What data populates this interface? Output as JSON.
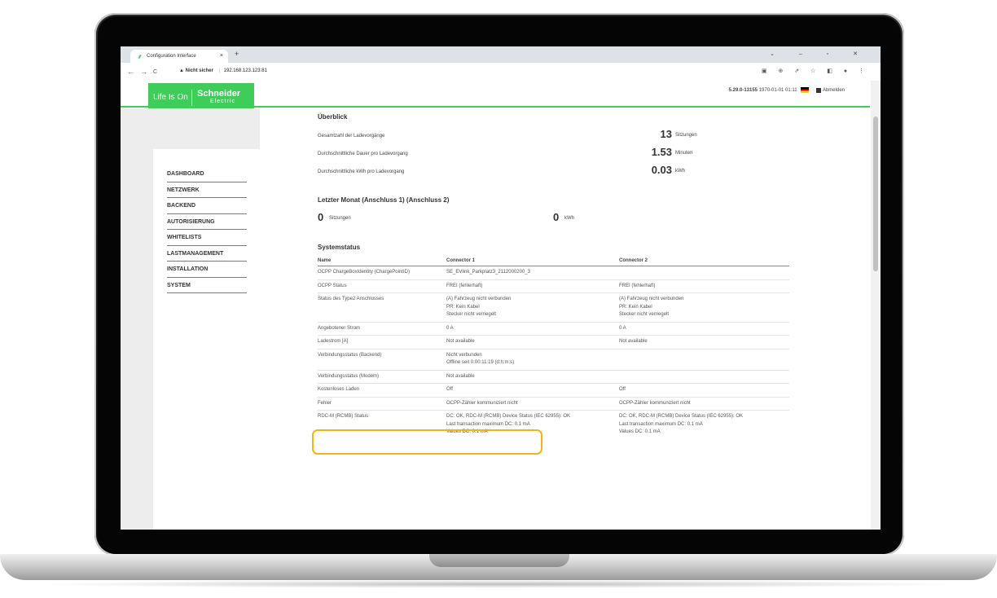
{
  "browser": {
    "tab_title": "Configuration Interface",
    "tab_close": "×",
    "new_tab": "+",
    "window_controls": "⌄ – ▫ ✕",
    "nav_back": "←",
    "nav_forward": "→",
    "nav_reload": "C",
    "url_warning": "▲ Nicht sicher",
    "url_host": "192.168.123.123:81",
    "toolbar_icons": "▣ ⊕ ⇗ ☆ ◧ ● ⋮"
  },
  "header": {
    "logo_tagline": "Life Is On",
    "logo_brand": "Schneider",
    "logo_brand_sub": "Electric",
    "version": "5.29.0-13155",
    "timestamp": "1970-01-01 01:11",
    "logout": "Abmelden",
    "accent_color": "#3dcd58"
  },
  "sidebar": {
    "items": [
      {
        "label": "DASHBOARD"
      },
      {
        "label": "NETZWERK"
      },
      {
        "label": "BACKEND"
      },
      {
        "label": "AUTORISIERUNG"
      },
      {
        "label": "WHITELISTS"
      },
      {
        "label": "LASTMANAGEMENT"
      },
      {
        "label": "INSTALLATION"
      },
      {
        "label": "SYSTEM"
      }
    ]
  },
  "overview": {
    "title": "Überblick",
    "rows": [
      {
        "label": "Gesamtzahl der Ladevorgänge",
        "value": "13",
        "unit": "Sitzungen"
      },
      {
        "label": "Durchschnittliche Dauer pro Ladevorgang",
        "value": "1.53",
        "unit": "Minuten"
      },
      {
        "label": "Durchschnittliche kWh pro Ladevorgang",
        "value": "0.03",
        "unit": "kWh"
      }
    ]
  },
  "last_month": {
    "title": "Letzter Monat (Anschluss 1) (Anschluss 2)",
    "sessions_value": "0",
    "sessions_unit": "Sitzungen",
    "kwh_value": "0",
    "kwh_unit": "kWh"
  },
  "system_status": {
    "title": "Systemstatus",
    "headers": [
      "Name",
      "Connector 1",
      "Connector 2"
    ],
    "rows": [
      {
        "name": "OCPP ChargeBoxIdentity (ChargePointID)",
        "c1": "SE_EVlink_Parkplatz3_2112000200_3",
        "c2": ""
      },
      {
        "name": "OCPP Status",
        "c1": "FREI (fehlerhaft)",
        "c2": "FREI (fehlerhaft)"
      },
      {
        "name": "Status des Type2 Anschlusses",
        "c1": "(A) Fahrzeug nicht verbunden\nPR: Kein Kabel\nStecker nicht verriegelt",
        "c2": "(A) Fahrzeug nicht verbunden\nPR: Kein Kabel\nStecker nicht verriegelt"
      },
      {
        "name": "Angebotener Strom",
        "c1": "0 A",
        "c2": "0 A"
      },
      {
        "name": "Ladestrom [A]",
        "c1": "Not available",
        "c2": "Not available"
      },
      {
        "name": "Verbindungsstatus (Backend)",
        "c1": "Nicht verbunden\nOffline seit 0:00:11:19 (d:h:m:s)",
        "c2": ""
      },
      {
        "name": "Verbindungsstatus (Modem)",
        "c1": "Not available",
        "c2": ""
      },
      {
        "name": "Kostenloses Laden",
        "c1": "Off",
        "c2": "Off"
      },
      {
        "name": "Fehler",
        "c1": "OCPP-Zähler kommuniziert nicht",
        "c2": "OCPP-Zähler kommuniziert nicht"
      },
      {
        "name": "RDC-M (RCMB) Status",
        "c1": "DC: OK, RDC-M (RCMB) Device Status (IEC 62955): OK\nLast transaction maximum DC: 0.1 mA\nValues DC: 0.1 mA",
        "c2": "DC: OK, RDC-M (RCMB) Device Status (IEC 62955): OK\nLast transaction maximum DC: 0.1 mA\nValues DC: 0.1 mA"
      }
    ],
    "highlight_color": "#f0b323"
  }
}
